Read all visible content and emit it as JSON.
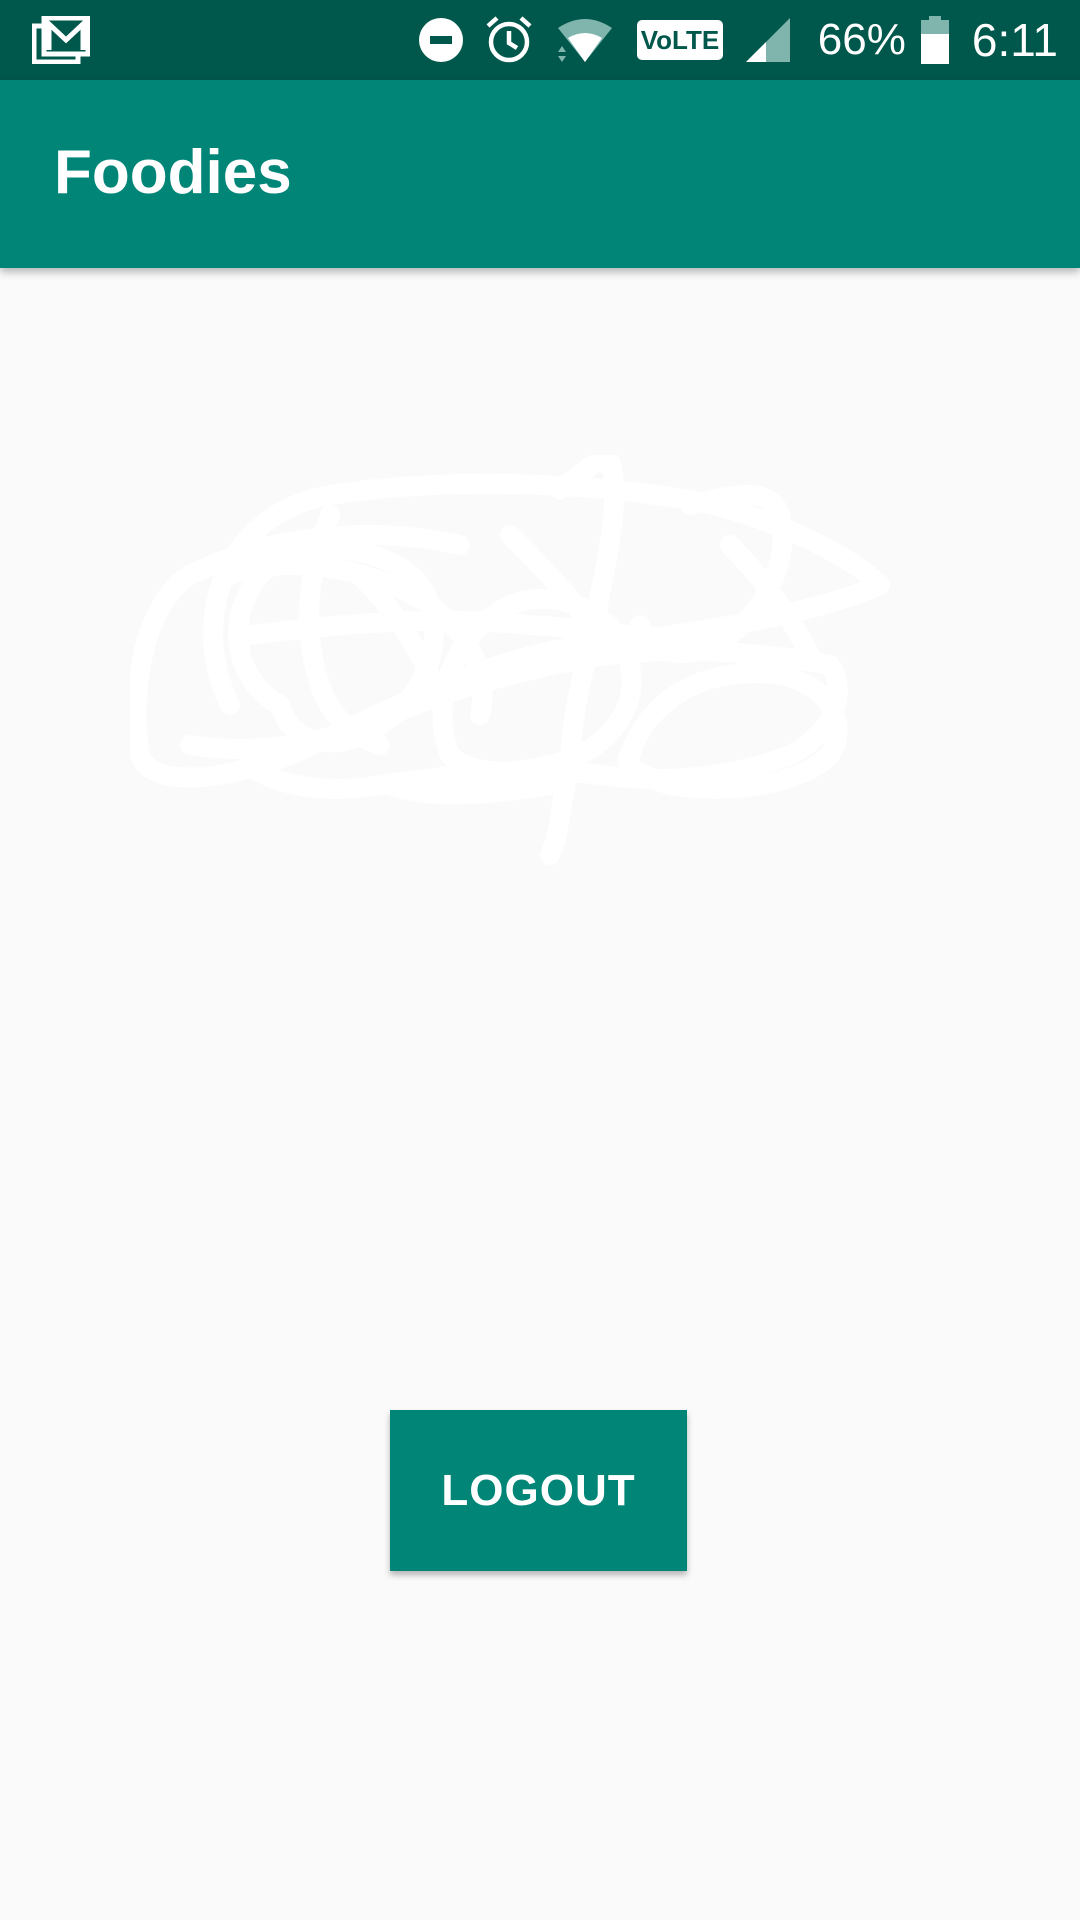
{
  "status_bar": {
    "icons": [
      "gmail-icon",
      "do-not-disturb-icon",
      "alarm-icon",
      "wifi-icon",
      "volte-icon",
      "signal-icon",
      "battery-icon"
    ],
    "volte_label": "VoLTE",
    "battery_percent": "66%",
    "time": "6:11"
  },
  "app_bar": {
    "title": "Foodies"
  },
  "main": {
    "profile_image": "scribbled-out-image",
    "logout_label": "LOGOUT"
  },
  "colors": {
    "status_bar": "#00574B",
    "primary": "#008577",
    "background": "#FAFAFA",
    "on_primary": "#FFFFFF"
  }
}
